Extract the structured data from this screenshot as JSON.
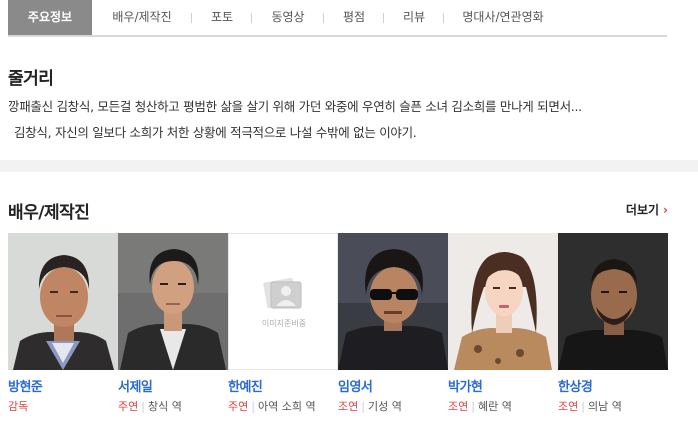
{
  "tabs": [
    {
      "label": "주요정보",
      "active": true
    },
    {
      "label": "배우/제작진",
      "active": false
    },
    {
      "label": "포토",
      "active": false
    },
    {
      "label": "동영상",
      "active": false
    },
    {
      "label": "평점",
      "active": false
    },
    {
      "label": "리뷰",
      "active": false
    },
    {
      "label": "명대사/연관영화",
      "active": false
    }
  ],
  "synopsis": {
    "title": "줄거리",
    "line1": "깡패출신 김창식, 모든걸 청산하고 평범한 삶을 살기 위해 가던 와중에 우연히 슬픈 소녀 김소희를 만나게 되면서...",
    "line2": "김창식, 자신의 일보다 소희가 처한 상황에 적극적으로 나설 수밖에 없는 이야기."
  },
  "cast": {
    "title": "배우/제작진",
    "more_label": "더보기",
    "more_arrow": "›",
    "placeholder_text": "이미지준비중",
    "members": [
      {
        "name": "방현준",
        "role_type": "감독",
        "role": ""
      },
      {
        "name": "서제일",
        "role_type": "주연",
        "role": "창식 역"
      },
      {
        "name": "한예진",
        "role_type": "주연",
        "role": "아역 소희 역"
      },
      {
        "name": "임영서",
        "role_type": "조연",
        "role": "기성 역"
      },
      {
        "name": "박가현",
        "role_type": "조연",
        "role": "혜란 역"
      },
      {
        "name": "한상경",
        "role_type": "조연",
        "role": "의남 역"
      }
    ]
  },
  "colors": {
    "active_tab_bg": "#8a8a8a",
    "name_link": "#2a6bd3",
    "role_type": "#e04040"
  }
}
